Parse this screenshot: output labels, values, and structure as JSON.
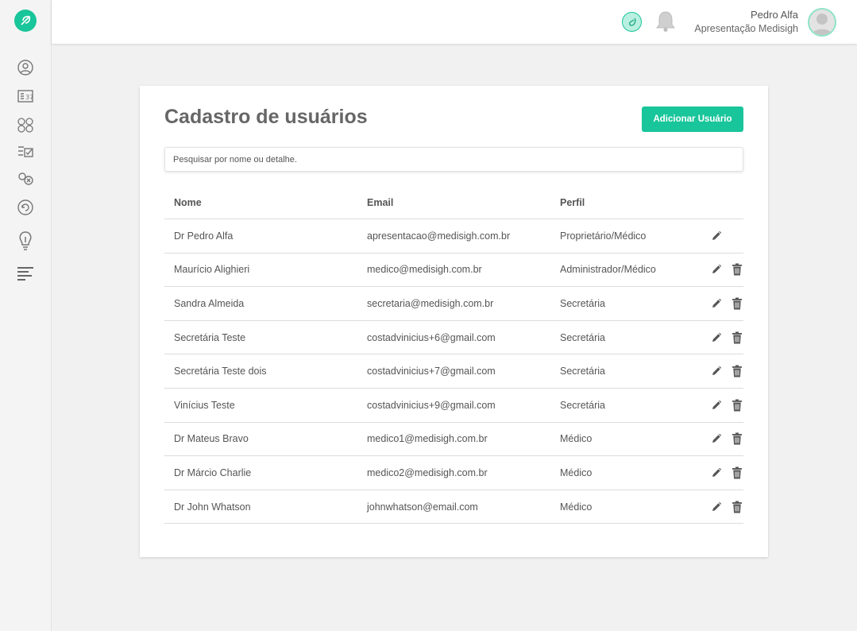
{
  "header": {
    "user_name": "Pedro Alfa",
    "user_org": "Apresentação Medisigh"
  },
  "sidebar": {
    "items": [
      {
        "icon": "doctor-icon"
      },
      {
        "icon": "calendar-icon"
      },
      {
        "icon": "team-icon"
      },
      {
        "icon": "checklist-icon"
      },
      {
        "icon": "cancel-check-icon"
      },
      {
        "icon": "refresh-icon"
      },
      {
        "icon": "idea-icon"
      },
      {
        "icon": "report-lines-icon"
      }
    ]
  },
  "page": {
    "title": "Cadastro de usuários",
    "add_button": "Adicionar Usuário",
    "search_placeholder": "Pesquisar por nome ou detalhe."
  },
  "table": {
    "columns": [
      "Nome",
      "Email",
      "Perfil"
    ],
    "rows": [
      {
        "nome": "Dr Pedro Alfa",
        "email": "apresentacao@medisigh.com.br",
        "perfil": "Proprietário/Médico",
        "deletable": false
      },
      {
        "nome": "Maurício Alighieri",
        "email": "medico@medisigh.com.br",
        "perfil": "Administrador/Médico",
        "deletable": true
      },
      {
        "nome": "Sandra Almeida",
        "email": "secretaria@medisigh.com.br",
        "perfil": "Secretária",
        "deletable": true
      },
      {
        "nome": "Secretária Teste",
        "email": "costadvinicius+6@gmail.com",
        "perfil": "Secretária",
        "deletable": true
      },
      {
        "nome": "Secretária Teste dois",
        "email": "costadvinicius+7@gmail.com",
        "perfil": "Secretária",
        "deletable": true
      },
      {
        "nome": "Vinícius Teste",
        "email": "costadvinicius+9@gmail.com",
        "perfil": "Secretária",
        "deletable": true
      },
      {
        "nome": "Dr Mateus Bravo",
        "email": "medico1@medisigh.com.br",
        "perfil": "Médico",
        "deletable": true
      },
      {
        "nome": "Dr Márcio Charlie",
        "email": "medico2@medisigh.com.br",
        "perfil": "Médico",
        "deletable": true
      },
      {
        "nome": "Dr John Whatson",
        "email": "johnwhatson@email.com",
        "perfil": "Médico",
        "deletable": true
      }
    ]
  },
  "colors": {
    "accent": "#19c59a",
    "background": "#f1f1f1",
    "text": "#555555"
  }
}
